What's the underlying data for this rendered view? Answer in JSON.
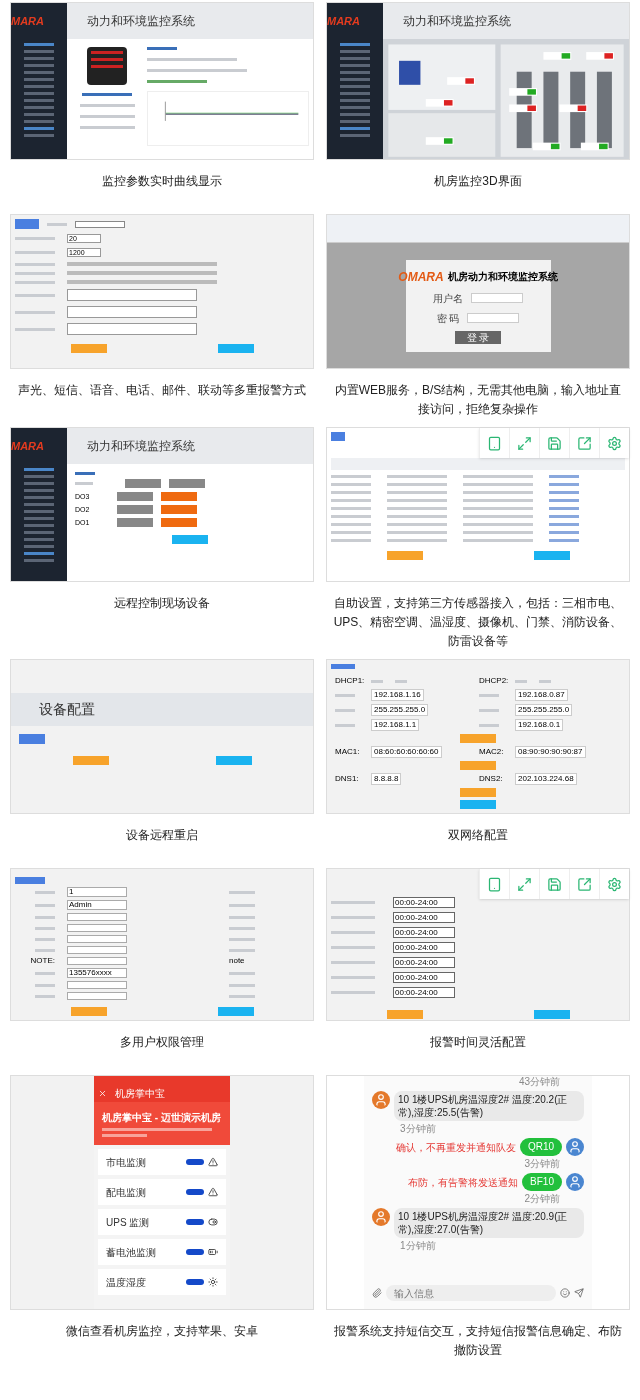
{
  "panels": [
    {
      "kind": "monitor",
      "logo": "MARA",
      "title": "动力和环境监控系统",
      "caption": "监控参数实时曲线显示"
    },
    {
      "kind": "floorplan",
      "logo": "MARA",
      "title": "动力和环境监控系统",
      "caption": "机房监控3D界面"
    },
    {
      "kind": "alarm_form",
      "inputs": [
        "20",
        "1200"
      ],
      "caption": "声光、短信、语音、电话、邮件、联动等多重报警方式"
    },
    {
      "kind": "login",
      "logo": "OMARA",
      "title": "机房动力和环境监控系统",
      "fields": [
        "用户名",
        "密 码"
      ],
      "button": "登 录",
      "caption": "内置WEB服务，B/S结构，无需其他电脑，输入地址直接访问，拒绝复杂操作"
    },
    {
      "kind": "control",
      "logo": "MARA",
      "title": "动力和环境监控系统",
      "outputs": [
        "DO3",
        "DO2",
        "DO1"
      ],
      "caption": "远程控制现场设备"
    },
    {
      "kind": "sensor_table",
      "caption": "自助设置，支持第三方传感器接入，包括：三相市电、UPS、精密空调、温湿度、摄像机、门禁、消防设备、防雷设备等"
    },
    {
      "kind": "device_config",
      "title": "设备配置",
      "caption": "设备远程重启"
    },
    {
      "kind": "network",
      "rows": [
        {
          "left_label": "DHCP1:",
          "right_label": "DHCP2:"
        },
        {
          "left_value": "192.168.1.16",
          "right_value": "192.168.0.87"
        },
        {
          "left_value": "255.255.255.0",
          "right_value": "255.255.255.0"
        },
        {
          "left_value": "192.168.1.1",
          "right_value": "192.168.0.1"
        },
        {
          "left_label": "MAC1:",
          "left_value": "08:60:60:60:60:60",
          "right_label": "MAC2:",
          "right_value": "08:90:90:90:90:87"
        },
        {
          "left_label": "DNS1:",
          "left_value": "8.8.8.8",
          "right_label": "DNS2:",
          "right_value": "202.103.224.68"
        }
      ],
      "caption": "双网络配置"
    },
    {
      "kind": "users",
      "fields": [
        "1",
        "Admin",
        "135576xxxx"
      ],
      "note_label": "NOTE:",
      "note": "note",
      "caption": "多用户权限管理"
    },
    {
      "kind": "schedule",
      "times": [
        "00:00-24:00",
        "00:00-24:00",
        "00:00-24:00",
        "00:00-24:00",
        "00:00-24:00",
        "00:00-24:00",
        "00:00-24:00"
      ],
      "caption": "报警时间灵活配置"
    },
    {
      "kind": "phone",
      "app_title": "机房掌中宝",
      "heading": "机房掌中宝 - 迈世演示机房",
      "items": [
        {
          "label": "市电监测",
          "kind": "warning"
        },
        {
          "label": "配电监测",
          "kind": "warning"
        },
        {
          "label": "UPS 监测",
          "kind": "toggle"
        },
        {
          "label": "蓄电池监测",
          "kind": "battery"
        },
        {
          "label": "温度湿度",
          "kind": "sun"
        }
      ],
      "caption": "微信查看机房监控，支持苹果、安卓"
    },
    {
      "kind": "chat",
      "messages": [
        {
          "kind": "in",
          "text": "10 1楼UPS机房温湿度2# 温度:20.2(正常),湿度:25.5(告警)",
          "time": "3分钟前"
        },
        {
          "kind": "out",
          "text": "QR10",
          "note": "确认，不再重发并通知队友",
          "time": "3分钟前"
        },
        {
          "kind": "out",
          "text": "BF10",
          "note": "布防，有告警将发送通知",
          "time": "2分钟前"
        },
        {
          "kind": "in",
          "text": "10 1楼UPS机房温湿度2# 温度:20.9(正常),湿度:27.0(告警)",
          "time": "1分钟前"
        }
      ],
      "top_time": "43分钟前",
      "placeholder": "输入信息",
      "caption": "报警系统支持短信交互，支持短信报警信息确定、布防撤防设置"
    }
  ]
}
